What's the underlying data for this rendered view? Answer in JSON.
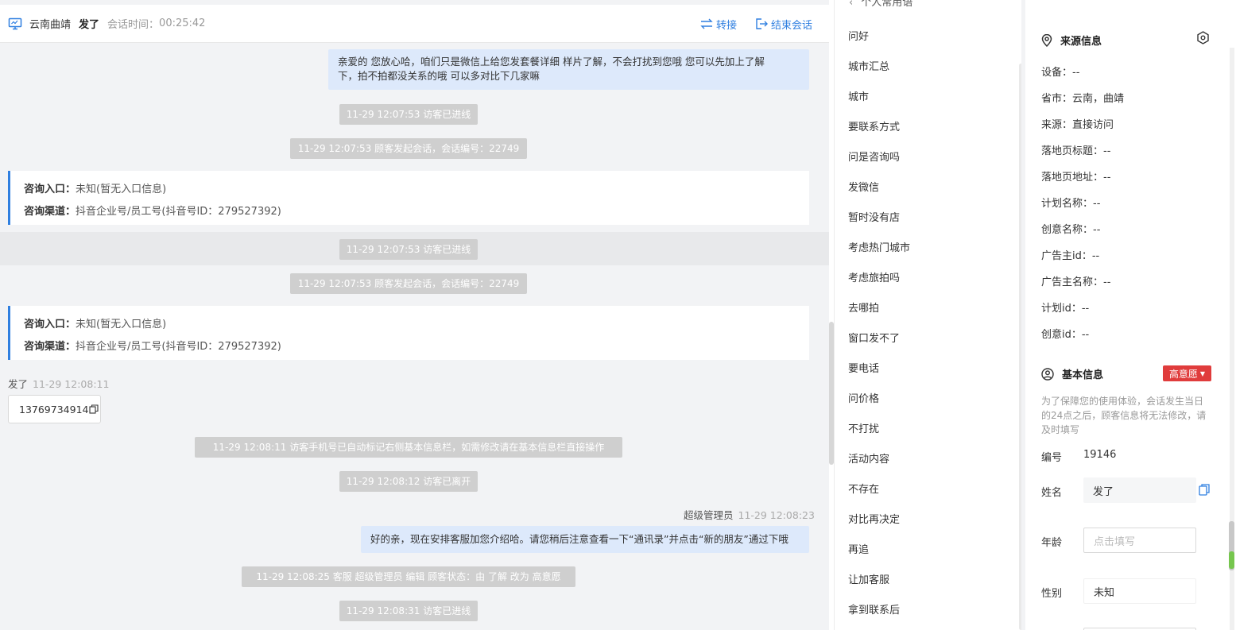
{
  "header": {
    "location": "云南曲靖",
    "visitor_name": "发了",
    "session_time_label": "会话时间：",
    "session_time": "00:25:42",
    "transfer_label": "转接",
    "end_label": "结束会话"
  },
  "chat": {
    "agent_msg_1": {
      "line1": "亲爱的 您放心哈，咱们只是微信上给您发套餐详细 样片了解，不会打扰到您哦 您可以先加上了解",
      "line2": "下，拍不拍都没关系的哦 可以多对比下几家嘛"
    },
    "sys_1": "11-29 12:07:53 访客已进线",
    "sys_2": "11-29 12:07:53 顾客发起会话，会话编号：22749",
    "card_1": {
      "entry_label": "咨询入口：",
      "entry_value": "未知(暂无入口信息)",
      "channel_label": "咨询渠道：",
      "channel_value": "抖音企业号/员工号(抖音号ID：279527392)"
    },
    "sys_3": "11-29 12:07:53 访客已进线",
    "sys_4": "11-29 12:07:53 顾客发起会话，会话编号：22749",
    "card_2": {
      "entry_label": "咨询入口：",
      "entry_value": "未知(暂无入口信息)",
      "channel_label": "咨询渠道：",
      "channel_value": "抖音企业号/员工号(抖音号ID：279527392)"
    },
    "visitor_sender": "发了",
    "visitor_time": "11-29 12:08:11",
    "visitor_phone": "13769734914",
    "sys_5": "11-29 12:08:11 访客手机号已自动标记右侧基本信息栏，如需修改请在基本信息栏直接操作",
    "sys_6": "11-29 12:08:12 访客已离开",
    "agent_sender": "超级管理员",
    "agent_time": "11-29 12:08:23",
    "agent_msg_2": "好的亲，现在安排客服加您介绍哈。请您稍后注意查看一下“通讯录”并点击“新的朋友”通过下哦",
    "sys_7": "11-29 12:08:25 客服 超级管理员 编辑 顾客状态：由 了解 改为 高意愿",
    "sys_8": "11-29 12:08:31 访客已进线"
  },
  "phrases": {
    "top_partial": "个人常用语",
    "items": [
      "问好",
      "城市汇总",
      "城市",
      "要联系方式",
      "问是咨询吗",
      "发微信",
      "暂时没有店",
      "考虑热门城市",
      "考虑旅拍吗",
      "去哪拍",
      "窗口发不了",
      "要电话",
      "问价格",
      "不打扰",
      "活动内容",
      "不存在",
      "对比再决定",
      "再追",
      "让加客服",
      "拿到联系后"
    ]
  },
  "source": {
    "title": "来源信息",
    "device": "设备：--",
    "province": "省市：云南，曲靖",
    "origin": "来源：直接访问",
    "landing_title": "落地页标题：--",
    "landing_url": "落地页地址：--",
    "plan_name": "计划名称：--",
    "creative_name": "创意名称：--",
    "advertiser_id": "广告主id：--",
    "advertiser_name": "广告主名称：--",
    "plan_id": "计划id：--",
    "creative_id": "创意id：--"
  },
  "basic": {
    "title": "基本信息",
    "intent_badge": "高意愿",
    "notice": "为了保障您的使用体验，会话发生当日的24点之后，顾客信息将无法修改，请及时填写",
    "id_label": "编号",
    "id_value": "19146",
    "name_label": "姓名",
    "name_value": "发了",
    "age_label": "年龄",
    "age_placeholder": "点击填写",
    "gender_label": "性别",
    "gender_value": "未知"
  },
  "colors": {
    "accent": "#2f7fe0",
    "badge": "#e03c3c",
    "bubble": "#dde9fb"
  }
}
